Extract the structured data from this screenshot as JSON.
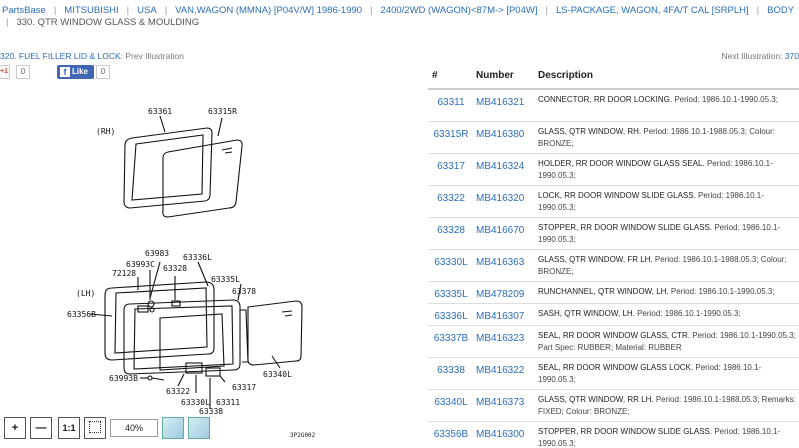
{
  "breadcrumb": {
    "items": [
      "PartsBase",
      "MITSUBISHI",
      "USA",
      "VAN,WAGON (MMNA) [P04V/W] 1986-1990",
      "2400/2WD (WAGON)<87M-> [P04W]",
      "LS-PACKAGE, WAGON, 4FA/T CAL [SRPLH]",
      "BODY"
    ],
    "current": "330. QTR WINDOW GLASS & MOULDING"
  },
  "nav": {
    "prev_link": "320. FUEL FILLER LID & LOCK",
    "prev_suffix": ": Prev Illustration",
    "next_prefix": "Next Illustration: ",
    "next_link": "370"
  },
  "social": {
    "gplus": "+1",
    "gplus_count": "0",
    "like": "Like",
    "like_count": "0"
  },
  "diagram": {
    "callouts": [
      "63361",
      "63315R",
      "(RH)",
      "63983",
      "63336L",
      "63993C",
      "63328",
      "72128",
      "63335L",
      "63378",
      "(LH)",
      "63356B",
      "63340L",
      "63993B",
      "63317",
      "63322",
      "63330L",
      "63311",
      "63338"
    ],
    "code": "3P2G002"
  },
  "toolbar": {
    "zoom_in": "+",
    "zoom_out": "—",
    "actual": "1:1",
    "zoom": "40%"
  },
  "table": {
    "headers": [
      "#",
      "Number",
      "Description"
    ],
    "rows": [
      {
        "num": "63311",
        "part": "MB416321",
        "name": "CONNECTOR, RR DOOR LOCKING.",
        "detail": "Period: 1986.10.1-1990.05.3;"
      },
      {
        "num": "63315R",
        "part": "MB416380",
        "name": "GLASS, QTR WINDOW, RH.",
        "detail": "Period: 1986.10.1-1988.05.3; Colour: BRONZE;"
      },
      {
        "num": "63317",
        "part": "MB416324",
        "name": "HOLDER, RR DOOR WINDOW GLASS SEAL.",
        "detail": "Period: 1986.10.1-1990.05.3;"
      },
      {
        "num": "63322",
        "part": "MB416320",
        "name": "LOCK, RR DOOR WINDOW SLIDE GLASS.",
        "detail": "Period: 1986.10.1-1990.05.3;"
      },
      {
        "num": "63328",
        "part": "MB416670",
        "name": "STOPPER, RR DOOR WINDOW SLIDE GLASS.",
        "detail": "Period: 1986.10.1-1990.05.3;"
      },
      {
        "num": "63330L",
        "part": "MB416363",
        "name": "GLASS, QTR WINDOW, FR LH.",
        "detail": "Period: 1986.10.1-1988.05.3; Colour: BRONZE;"
      },
      {
        "num": "63335L",
        "part": "MB478209",
        "name": "RUNCHANNEL, QTR WINDOW, LH.",
        "detail": "Period: 1986.10.1-1990.05.3;"
      },
      {
        "num": "63336L",
        "part": "MB416307",
        "name": "SASH, QTR WINDOW, LH.",
        "detail": "Period: 1986.10.1-1990.05.3;"
      },
      {
        "num": "63337B",
        "part": "MB416323",
        "name": "SEAL, RR DOOR WINDOW GLASS, CTR.",
        "detail": "Period: 1986.10.1-1990.05.3; Part Spec: RUBBER; Material: RUBBER"
      },
      {
        "num": "63338",
        "part": "MB416322",
        "name": "SEAL, RR DOOR WINDOW GLASS LOCK.",
        "detail": "Period: 1986.10.1-1990.05.3;"
      },
      {
        "num": "63340L",
        "part": "MB416373",
        "name": "GLASS, QTR WINDOW, RR LH.",
        "detail": "Period: 1986.10.1-1988.05.3; Remarks: FIXED; Colour: BRONZE;"
      },
      {
        "num": "63356B",
        "part": "MB416300",
        "name": "STOPPER, RR DOOR WINDOW SLIDE GLASS.",
        "detail": "Period: 1986.10.1-1990.05.3;"
      }
    ]
  }
}
